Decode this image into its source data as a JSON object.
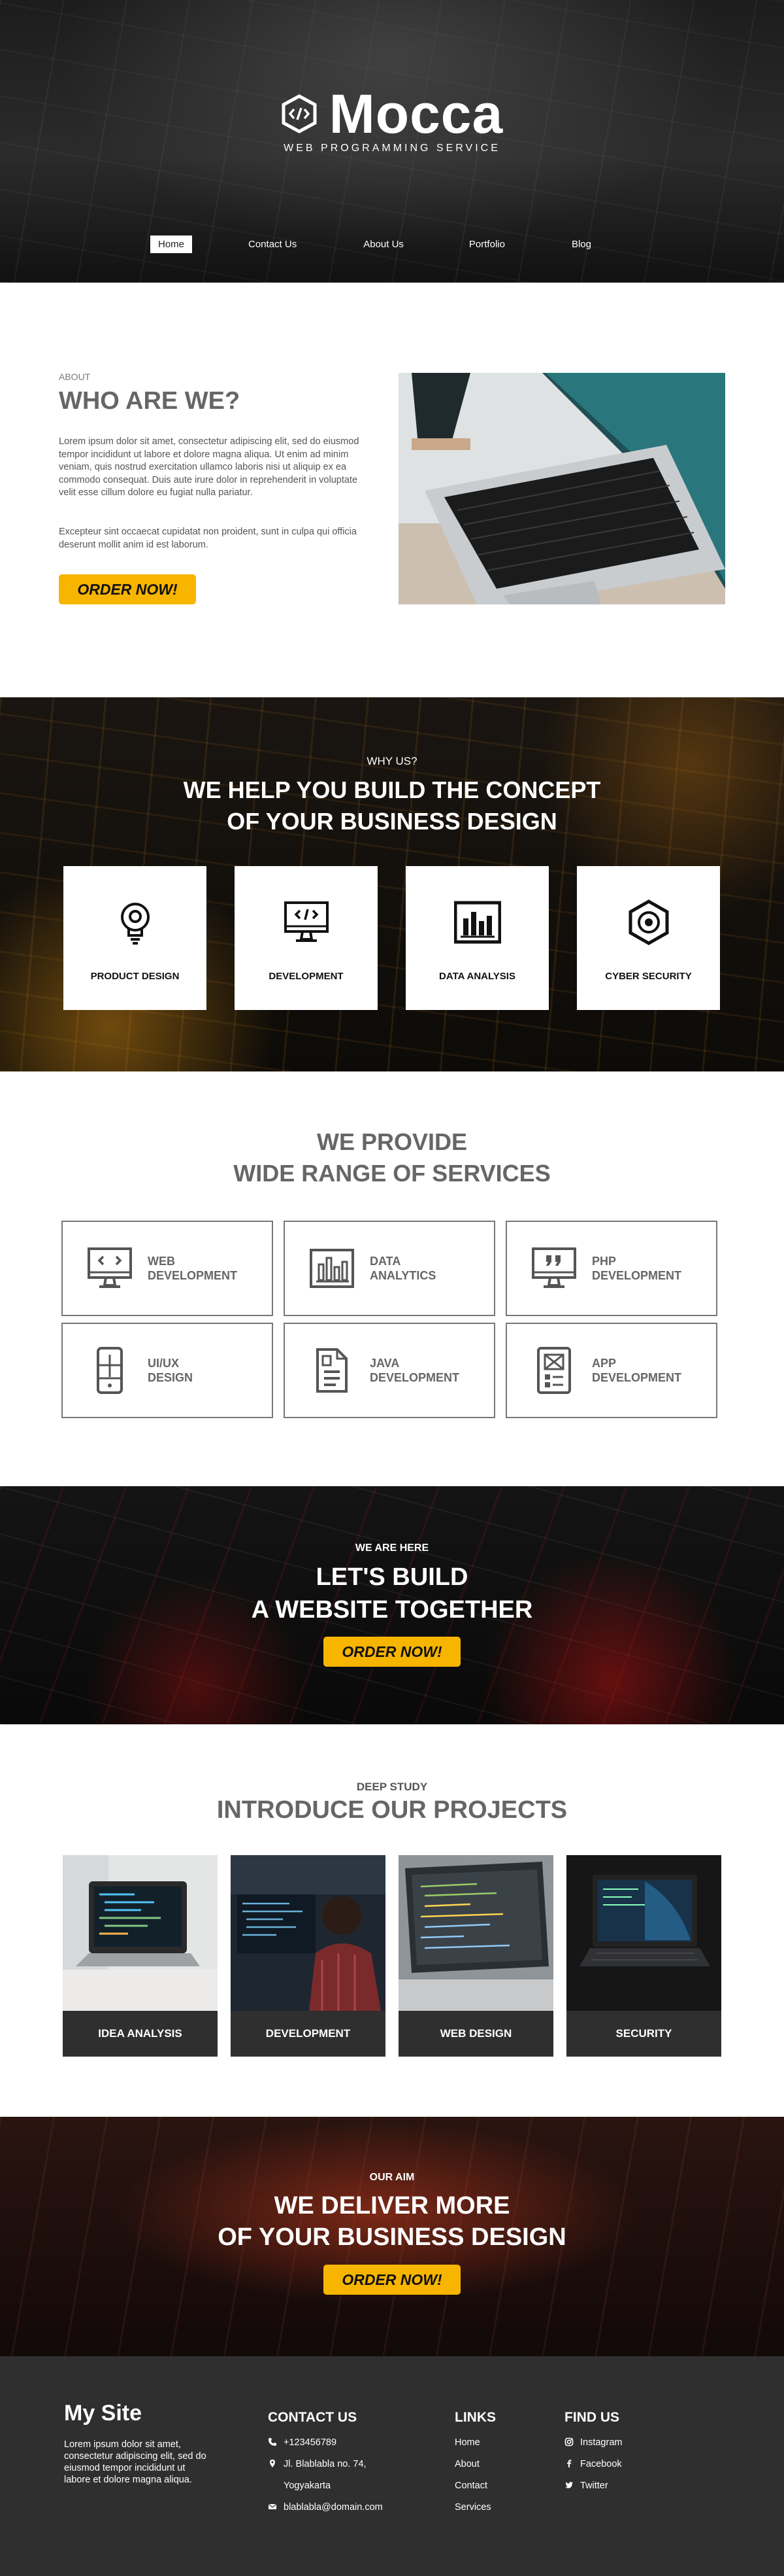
{
  "hero": {
    "brand": "Mocca",
    "tagline": "WEB PROGRAMMING SERVICE",
    "nav": [
      {
        "label": "Home",
        "active": true
      },
      {
        "label": "Contact Us",
        "active": false
      },
      {
        "label": "About Us",
        "active": false
      },
      {
        "label": "Portfolio",
        "active": false
      },
      {
        "label": "Blog",
        "active": false
      }
    ]
  },
  "about": {
    "eyebrow": "ABOUT",
    "title": "WHO ARE WE?",
    "paragraph1": "Lorem ipsum dolor sit amet, consectetur adipiscing elit, sed do eiusmod tempor incididunt ut labore et dolore magna aliqua. Ut enim ad minim veniam, quis nostrud exercitation ullamco laboris nisi ut aliquip ex ea commodo consequat. Duis aute irure dolor in reprehenderit in voluptate velit esse cillum dolore eu fugiat nulla pariatur.",
    "paragraph2": "Excepteur sint occaecat cupidatat non proident, sunt in culpa qui officia deserunt mollit anim id est laborum.",
    "button": "ORDER NOW!"
  },
  "whyus": {
    "eyebrow": "WHY US?",
    "title_line1": "WE HELP YOU BUILD THE CONCEPT",
    "title_line2": "OF YOUR BUSINESS DESIGN",
    "cards": [
      {
        "label": "PRODUCT DESIGN",
        "icon": "lightbulb-icon"
      },
      {
        "label": "DEVELOPMENT",
        "icon": "monitor-code-icon"
      },
      {
        "label": "DATA ANALYSIS",
        "icon": "bar-chart-icon"
      },
      {
        "label": "CYBER SECURITY",
        "icon": "hexagon-target-icon"
      }
    ]
  },
  "services": {
    "title_line1": "WE PROVIDE",
    "title_line2": "WIDE RANGE OF SERVICES",
    "items": [
      {
        "line1": "WEB",
        "line2": "DEVELOPMENT",
        "icon": "monitor-code-icon"
      },
      {
        "line1": "DATA",
        "line2": "ANALYTICS",
        "icon": "bar-chart-icon"
      },
      {
        "line1": "PHP",
        "line2": "DEVELOPMENT",
        "icon": "monitor-quote-icon"
      },
      {
        "line1": "UI/UX",
        "line2": "DESIGN",
        "icon": "mobile-layout-icon"
      },
      {
        "line1": "JAVA",
        "line2": "DEVELOPMENT",
        "icon": "document-code-icon"
      },
      {
        "line1": "APP",
        "line2": "DEVELOPMENT",
        "icon": "mobile-app-icon"
      }
    ]
  },
  "cta1": {
    "eyebrow": "WE ARE HERE",
    "title_line1": "LET'S BUILD",
    "title_line2": "A WEBSITE TOGETHER",
    "button": "ORDER NOW!"
  },
  "projects": {
    "eyebrow": "DEEP STUDY",
    "title": "INTRODUCE OUR PROJECTS",
    "items": [
      {
        "label": "IDEA ANALYSIS"
      },
      {
        "label": "DEVELOPMENT"
      },
      {
        "label": "WEB DESIGN"
      },
      {
        "label": "SECURITY"
      }
    ]
  },
  "cta2": {
    "eyebrow": "OUR AIM",
    "title_line1": "WE DELIVER MORE",
    "title_line2": "OF YOUR BUSINESS DESIGN",
    "button": "ORDER NOW!"
  },
  "footer": {
    "site": "My Site",
    "site_desc": "Lorem ipsum dolor sit amet, consectetur adipiscing elit, sed do eiusmod tempor incididunt ut labore et dolore magna aliqua.",
    "contact_title": "CONTACT US",
    "contact": [
      {
        "icon": "phone-icon",
        "text": "+123456789"
      },
      {
        "icon": "location-pin-icon",
        "text": "Jl. Blablabla no. 74,"
      },
      {
        "icon": "",
        "text": "Yogyakarta"
      },
      {
        "icon": "mail-icon",
        "text": "blablabla@domain.com"
      }
    ],
    "links_title": "LINKS",
    "links": [
      "Home",
      "About",
      "Contact",
      "Services"
    ],
    "find_title": "FIND US",
    "social": [
      {
        "icon": "instagram-icon",
        "text": "Instagram"
      },
      {
        "icon": "facebook-icon",
        "text": "Facebook"
      },
      {
        "icon": "twitter-icon",
        "text": "Twitter"
      }
    ]
  },
  "colors": {
    "accent": "#f7b500",
    "dark": "#2f2f2f",
    "heading_gray": "#666666"
  }
}
